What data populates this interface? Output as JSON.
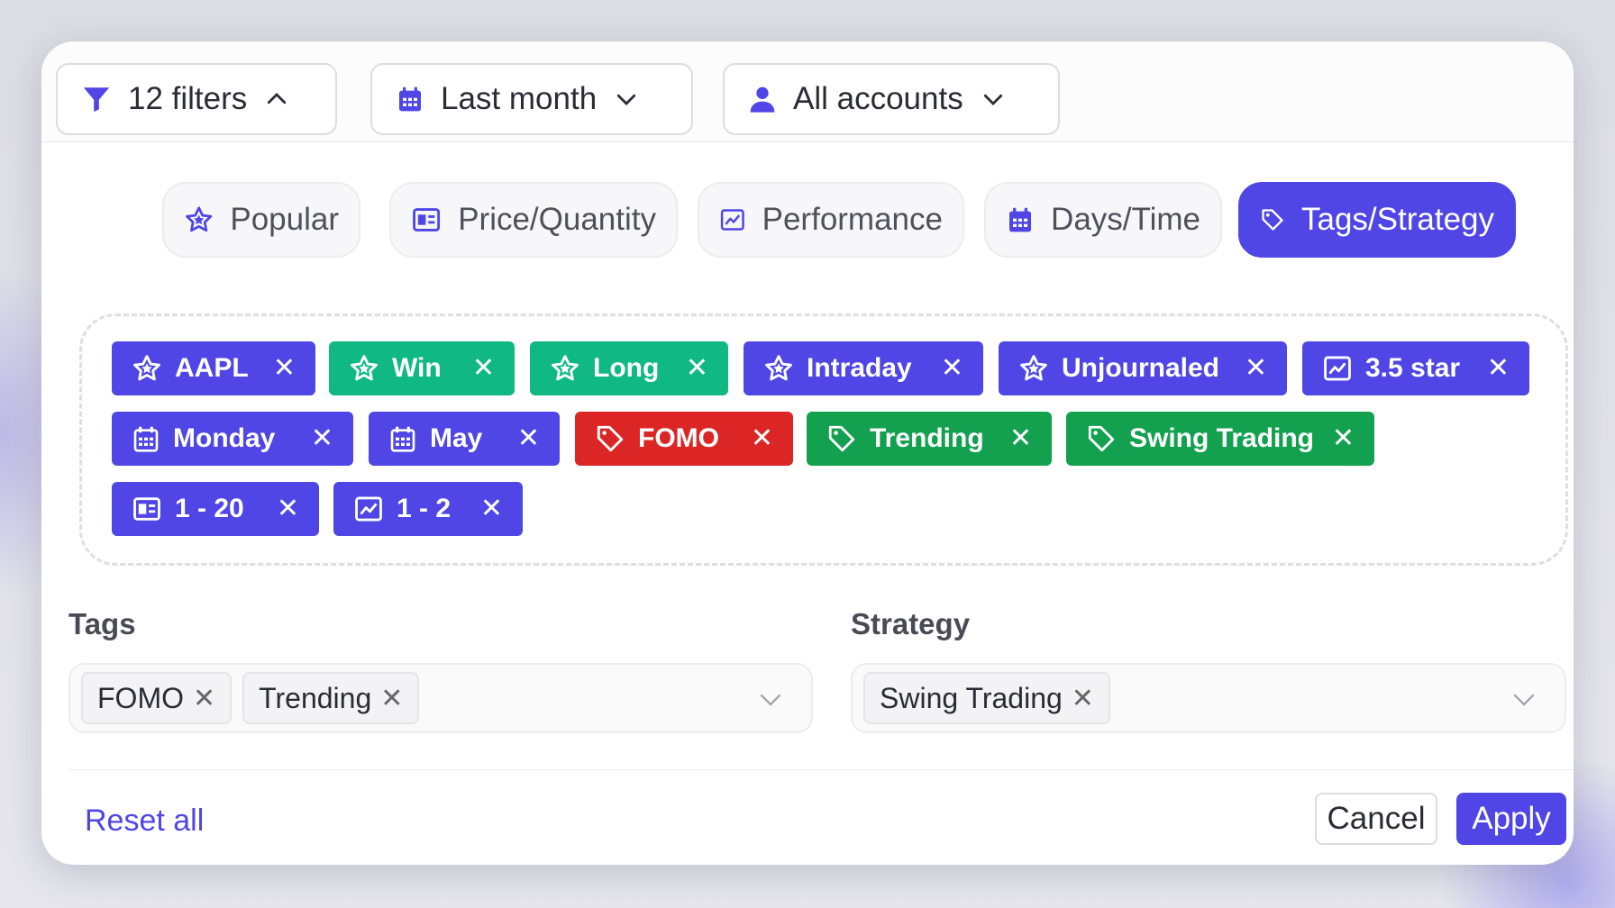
{
  "filters": {
    "count_label": "12 filters",
    "date_range": "Last month",
    "accounts": "All accounts"
  },
  "tabs": [
    {
      "label": "Popular",
      "icon": "star-icon",
      "active": false
    },
    {
      "label": "Price/Quantity",
      "icon": "price-tag-card-icon",
      "active": false
    },
    {
      "label": "Performance",
      "icon": "chart-icon",
      "active": false
    },
    {
      "label": "Days/Time",
      "icon": "calendar-icon",
      "active": false
    },
    {
      "label": "Tags/Strategy",
      "icon": "tag-icon",
      "active": true
    }
  ],
  "active_chips": [
    {
      "label": "AAPL",
      "icon": "star-icon",
      "color": "#4f46e5"
    },
    {
      "label": "Win",
      "icon": "star-icon",
      "color": "#10b981"
    },
    {
      "label": "Long",
      "icon": "star-icon",
      "color": "#10b981"
    },
    {
      "label": "Intraday",
      "icon": "star-icon",
      "color": "#4f46e5"
    },
    {
      "label": "Unjournaled",
      "icon": "star-icon",
      "color": "#4f46e5"
    },
    {
      "label": "3.5 star",
      "icon": "chart-icon",
      "color": "#4f46e5"
    },
    {
      "label": "Monday",
      "icon": "calendar-icon",
      "color": "#4f46e5"
    },
    {
      "label": "May",
      "icon": "calendar-icon",
      "color": "#4f46e5"
    },
    {
      "label": "FOMO",
      "icon": "tag-icon",
      "color": "#dc2626"
    },
    {
      "label": "Trending",
      "icon": "tag-icon",
      "color": "#13a04f"
    },
    {
      "label": "Swing Trading",
      "icon": "tag-icon",
      "color": "#13a04f"
    },
    {
      "label": "1 - 20",
      "icon": "price-tag-card-icon",
      "color": "#4f46e5"
    },
    {
      "label": "1 - 2",
      "icon": "chart-icon",
      "color": "#4f46e5"
    }
  ],
  "tags_field": {
    "label": "Tags",
    "values": [
      "FOMO",
      "Trending"
    ]
  },
  "strategy_field": {
    "label": "Strategy",
    "values": [
      "Swing Trading"
    ]
  },
  "footer": {
    "reset_label": "Reset all",
    "cancel_label": "Cancel",
    "apply_label": "Apply"
  },
  "colors": {
    "accent": "#4f46e5",
    "green": "#13a04f",
    "teal": "#10b981",
    "red": "#dc2626"
  }
}
